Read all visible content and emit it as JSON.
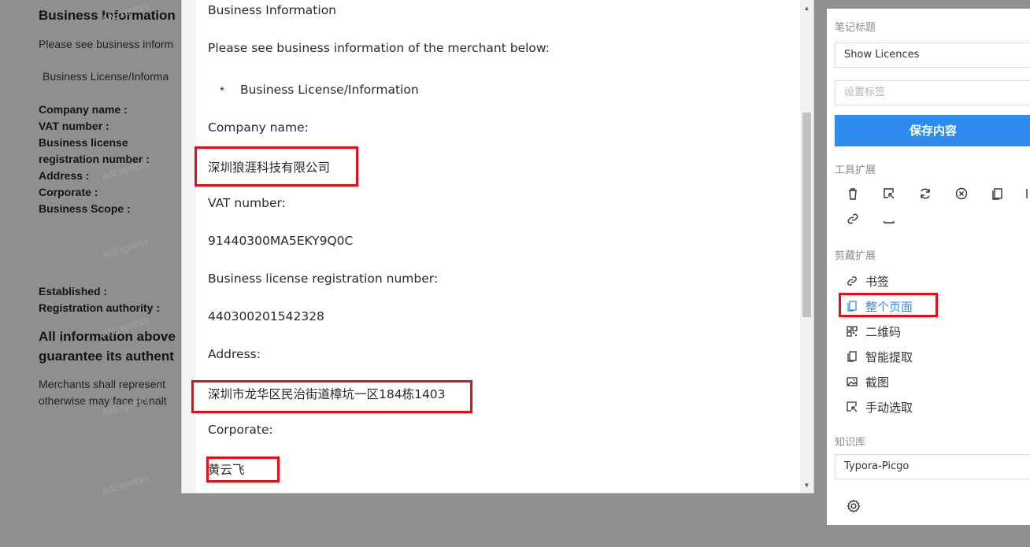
{
  "background": {
    "title": "Business Information",
    "intro": "Please see business inform",
    "license": "Business License/Informa",
    "labels": [
      "Company name :",
      "VAT number :",
      "Business license",
      "registration number :",
      "Address :",
      "Corporate :",
      "Business Scope :"
    ],
    "labels2": [
      "Established :",
      "Registration authority :"
    ],
    "heading_lines": [
      "All information above",
      "guarantee its authent"
    ],
    "note_lines": [
      "Merchants shall represent",
      "otherwise may face penalt"
    ],
    "watermark": "AliExpress"
  },
  "viewer": {
    "title": "Business Information",
    "intro": "Please see business information of the merchant below:",
    "bullet_marker": "*",
    "bullet_text": "Business License/Information",
    "company_label": "Company name:",
    "company_value": "深圳狼涯科技有限公司",
    "vat_label": "VAT number:",
    "vat_value": "91440300MA5EKY9Q0C",
    "reg_label": "Business license registration number:",
    "reg_value": "440300201542328",
    "address_label": "Address:",
    "address_value": "深圳市龙华区民治街道樟坑一区184栋1403",
    "corporate_label": "Corporate:",
    "corporate_value": "黄云飞"
  },
  "panel": {
    "note_title_label": "笔记标题",
    "note_title_value": "Show Licences",
    "tags_placeholder": "设置标签",
    "save_label": "保存内容",
    "tools_label": "工具扩展",
    "clip_label": "剪藏扩展",
    "clip_items": [
      {
        "label": "书签",
        "icon": "link-icon"
      },
      {
        "label": "整个页面",
        "icon": "copy-icon",
        "active": true
      },
      {
        "label": "二维码",
        "icon": "qrcode-icon"
      },
      {
        "label": "智能提取",
        "icon": "copy-icon"
      },
      {
        "label": "截图",
        "icon": "image-icon"
      },
      {
        "label": "手动选取",
        "icon": "select-icon"
      }
    ],
    "kb_label": "知识库",
    "kb_value": "Typora-Picgo",
    "accent": "#2d8cf0",
    "highlight": "#e0101a"
  }
}
